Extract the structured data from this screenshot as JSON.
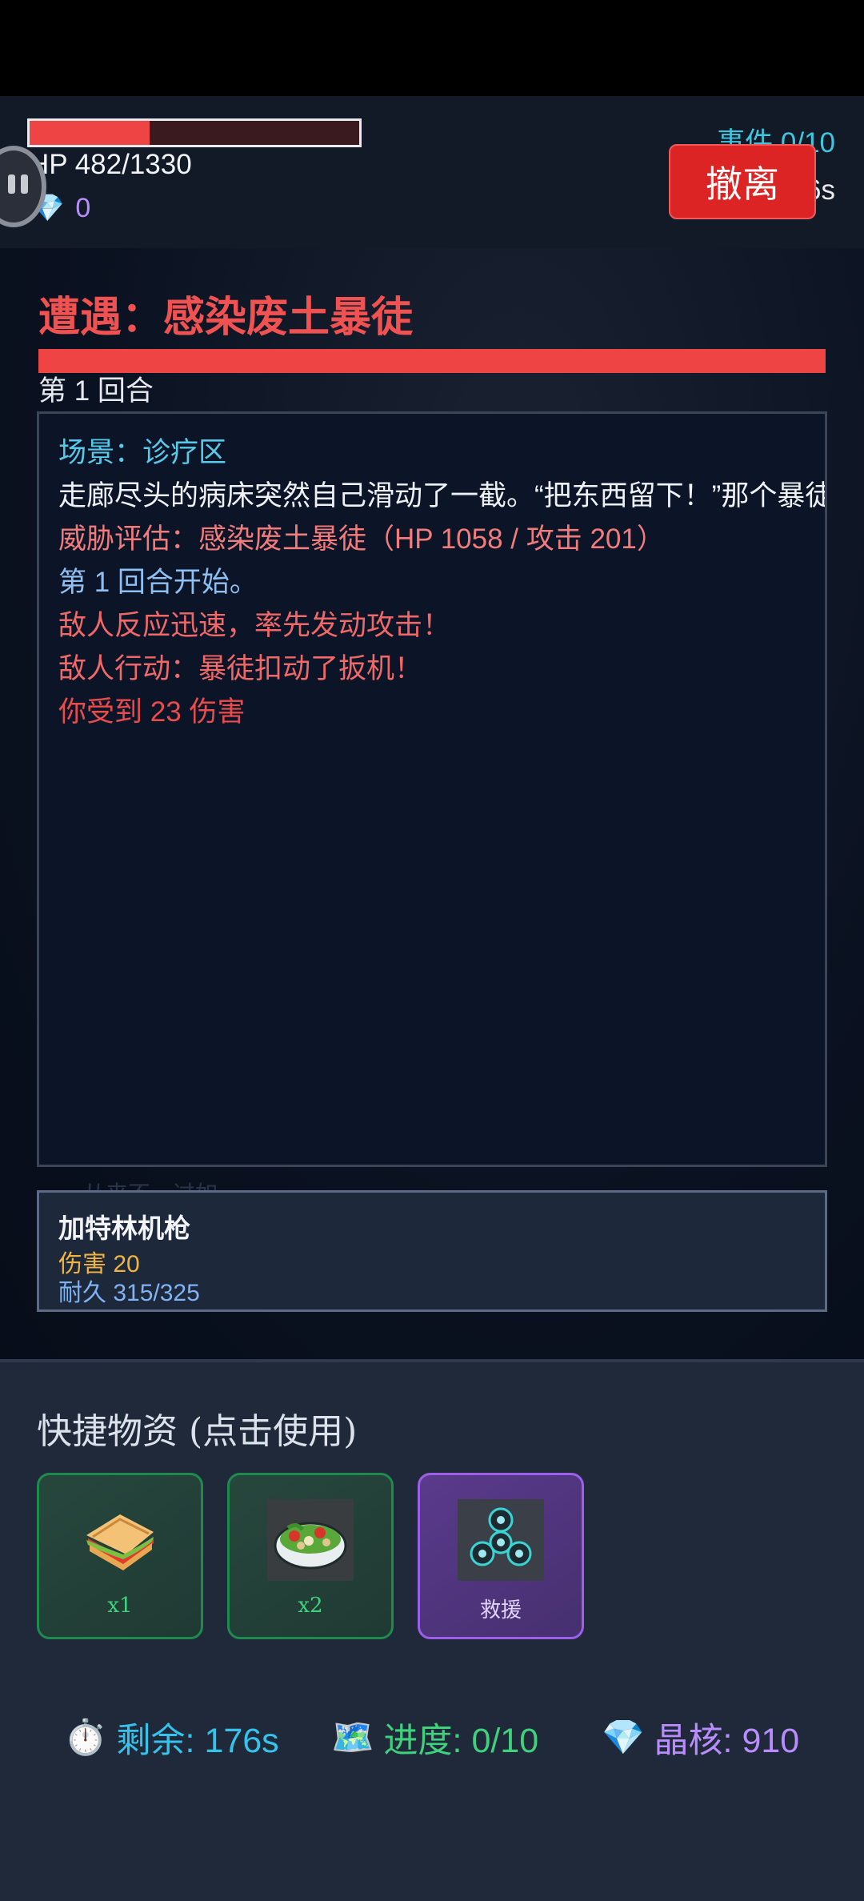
{
  "header": {
    "hp_fraction": 0.364,
    "hp_text": "HP 482/1330",
    "gems": "0",
    "event_count": "事件 0/10",
    "timer_partial": "6s",
    "evac_label": "撤离"
  },
  "encounter": {
    "title": "遭遇：感染废土暴徒",
    "enemy_hp_fraction": 1.0,
    "round_label": "第 1 回合"
  },
  "log": [
    {
      "text": "场景：诊疗区",
      "color": "#58c9e8"
    },
    {
      "text": "走廊尽头的病床突然自己滑动了一截。“把东西留下！”那个暴徒著",
      "color": "#eef1f5"
    },
    {
      "text": "威胁评估：感染废土暴徒（HP 1058 / 攻击 201）",
      "color": "#f27b7b"
    },
    {
      "text": "第 1 回合开始。",
      "color": "#8fc0f4"
    },
    {
      "text": "敌人反应迅速，率先发动攻击！",
      "color": "#f16868"
    },
    {
      "text": "敌人行动：暴徒扣动了扳机！",
      "color": "#f16868"
    },
    {
      "text": "你受到 23 伤害",
      "color": "#ea4b4b"
    }
  ],
  "faded_text": "…从来不…过如…",
  "weapon": {
    "name": "加特林机枪",
    "damage": "伤害 20",
    "durability": "耐久 315/325"
  },
  "quick_items": {
    "title": "快捷物资 (点击使用)",
    "items": [
      {
        "icon": "sandwich-icon",
        "label": "x1",
        "style": "green"
      },
      {
        "icon": "salad-icon",
        "label": "x2",
        "style": "green"
      },
      {
        "icon": "fidget-spinner-icon",
        "label": "救援",
        "style": "purple"
      }
    ]
  },
  "stats": {
    "remaining": "剩余: 176s",
    "progress": "进度: 0/10",
    "crystal": "晶核: 910"
  },
  "colors": {
    "accent_red": "#ef4444",
    "cyan": "#3ec6e0",
    "green": "#3fd17b",
    "purple": "#b98cff"
  }
}
